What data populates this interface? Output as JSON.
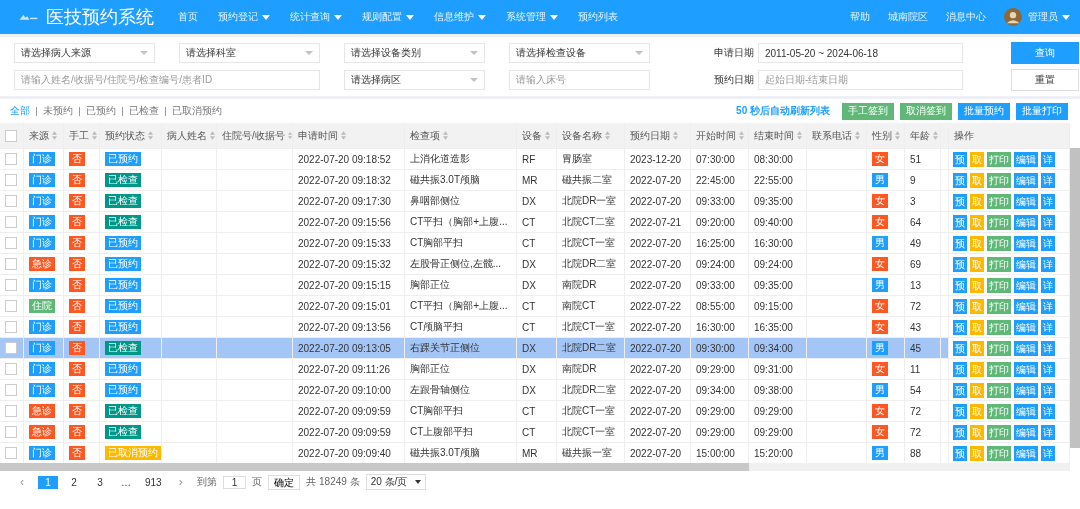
{
  "header": {
    "title": "医技预约系统",
    "nav": [
      {
        "label": "首页",
        "has_menu": false
      },
      {
        "label": "预约登记",
        "has_menu": true
      },
      {
        "label": "统计查询",
        "has_menu": true
      },
      {
        "label": "规则配置",
        "has_menu": true
      },
      {
        "label": "信息维护",
        "has_menu": true
      },
      {
        "label": "系统管理",
        "has_menu": true
      },
      {
        "label": "预约列表",
        "has_menu": false
      }
    ],
    "right_links": [
      "帮助",
      "城南院区",
      "消息中心"
    ],
    "user": "管理员"
  },
  "filters": {
    "row1": [
      {
        "kind": "select",
        "placeholder": "请选择病人来源"
      },
      {
        "kind": "select",
        "placeholder": "请选择科室"
      },
      {
        "kind": "select",
        "placeholder": "请选择设备类别"
      },
      {
        "kind": "select",
        "placeholder": "请选择检查设备"
      }
    ],
    "row2": [
      {
        "kind": "input",
        "placeholder": "请输入姓名/收据号/住院号/检查编号/患者ID"
      },
      {
        "kind": "select",
        "placeholder": "请选择病区"
      },
      {
        "kind": "input",
        "placeholder": "请输入床号"
      }
    ],
    "apply_date": {
      "label": "申请日期",
      "value": "2011-05-20 ~ 2024-06-18"
    },
    "book_date": {
      "label": "预约日期",
      "placeholder": "起始日期-结束日期"
    },
    "search_button": "查询",
    "reset_button": "重置"
  },
  "status_tabs": [
    {
      "label": "全部",
      "selected": true
    },
    {
      "label": "未预约",
      "selected": false
    },
    {
      "label": "已预约",
      "selected": false
    },
    {
      "label": "已检查",
      "selected": false
    },
    {
      "label": "已取消预约",
      "selected": false
    }
  ],
  "refresh_note": "50 秒后自动刷新列表",
  "toolbar_buttons": [
    {
      "label": "手工签到",
      "color": "#5fb878"
    },
    {
      "label": "取消签到",
      "color": "#5fb878"
    },
    {
      "label": "批量预约",
      "color": "#1e9fff"
    },
    {
      "label": "批量打印",
      "color": "#1e9fff"
    }
  ],
  "table": {
    "header_checkbox": {
      "checked": false
    },
    "columns": [
      {
        "label": "来源",
        "sortable": true
      },
      {
        "label": "手工",
        "sortable": true
      },
      {
        "label": "预约状态",
        "sortable": true
      },
      {
        "label": "病人姓名",
        "sortable": true
      },
      {
        "label": "住院号/收据号",
        "sortable": true
      },
      {
        "label": "申请时间",
        "sortable": true
      },
      {
        "label": "检查项",
        "sortable": true
      },
      {
        "label": "设备",
        "sortable": true
      },
      {
        "label": "设备名称",
        "sortable": true
      },
      {
        "label": "预约日期",
        "sortable": true
      },
      {
        "label": "开始时间",
        "sortable": true
      },
      {
        "label": "结束时间",
        "sortable": true
      },
      {
        "label": "联系电话",
        "sortable": true
      },
      {
        "label": "性别",
        "sortable": true
      },
      {
        "label": "年龄",
        "sortable": true
      },
      {
        "label": "操作",
        "sortable": false
      }
    ],
    "rows": [
      {
        "checked": false,
        "selected": false,
        "source": {
          "label": "门诊",
          "color": "#1e9fff"
        },
        "manual": {
          "label": "否",
          "color": "#ff5722"
        },
        "status": {
          "label": "已预约",
          "color": "#1e9fff"
        },
        "applied": "2022-07-20 09:18:52",
        "item": "上消化道造影",
        "device": "RF",
        "device_name": "胃肠室",
        "date": "2023-12-20",
        "start": "07:30:00",
        "end": "08:30:00",
        "gender": {
          "label": "女",
          "color": "#ff5722"
        },
        "age": "51",
        "actions": [
          {
            "label": "预",
            "color": "#1e9fff"
          },
          {
            "label": "取",
            "color": "#ffb800"
          },
          {
            "label": "打印",
            "color": "#5fb878"
          },
          {
            "label": "编辑",
            "color": "#1e9fff"
          },
          {
            "label": "详",
            "color": "#1e9fff"
          }
        ]
      },
      {
        "checked": false,
        "selected": false,
        "source": {
          "label": "门诊",
          "color": "#1e9fff"
        },
        "manual": {
          "label": "否",
          "color": "#ff5722"
        },
        "status": {
          "label": "已检查",
          "color": "#009688"
        },
        "applied": "2022-07-20 09:18:32",
        "item": "磁共振3.0T颅脑",
        "device": "MR",
        "device_name": "磁共振二室",
        "date": "2022-07-20",
        "start": "22:45:00",
        "end": "22:55:00",
        "gender": {
          "label": "男",
          "color": "#1e9fff"
        },
        "age": "9",
        "actions": [
          {
            "label": "预",
            "color": "#1e9fff"
          },
          {
            "label": "取",
            "color": "#ffb800"
          },
          {
            "label": "打印",
            "color": "#5fb878"
          },
          {
            "label": "编辑",
            "color": "#1e9fff"
          },
          {
            "label": "详",
            "color": "#1e9fff"
          }
        ]
      },
      {
        "checked": false,
        "selected": false,
        "source": {
          "label": "门诊",
          "color": "#1e9fff"
        },
        "manual": {
          "label": "否",
          "color": "#ff5722"
        },
        "status": {
          "label": "已检查",
          "color": "#009688"
        },
        "applied": "2022-07-20 09:17:30",
        "item": "鼻咽部侧位",
        "device": "DX",
        "device_name": "北院DR一室",
        "date": "2022-07-20",
        "start": "09:33:00",
        "end": "09:35:00",
        "gender": {
          "label": "女",
          "color": "#ff5722"
        },
        "age": "3",
        "actions": [
          {
            "label": "预",
            "color": "#1e9fff"
          },
          {
            "label": "取",
            "color": "#ffb800"
          },
          {
            "label": "打印",
            "color": "#5fb878"
          },
          {
            "label": "编辑",
            "color": "#1e9fff"
          },
          {
            "label": "详",
            "color": "#1e9fff"
          }
        ]
      },
      {
        "checked": false,
        "selected": false,
        "source": {
          "label": "门诊",
          "color": "#1e9fff"
        },
        "manual": {
          "label": "否",
          "color": "#ff5722"
        },
        "status": {
          "label": "已检查",
          "color": "#009688"
        },
        "applied": "2022-07-20 09:15:56",
        "item": "CT平扫（胸部+上腹...",
        "device": "CT",
        "device_name": "北院CT二室",
        "date": "2022-07-21",
        "start": "09:20:00",
        "end": "09:40:00",
        "gender": {
          "label": "女",
          "color": "#ff5722"
        },
        "age": "64",
        "actions": [
          {
            "label": "预",
            "color": "#1e9fff"
          },
          {
            "label": "取",
            "color": "#ffb800"
          },
          {
            "label": "打印",
            "color": "#5fb878"
          },
          {
            "label": "编辑",
            "color": "#1e9fff"
          },
          {
            "label": "详",
            "color": "#1e9fff"
          }
        ]
      },
      {
        "checked": false,
        "selected": false,
        "source": {
          "label": "门诊",
          "color": "#1e9fff"
        },
        "manual": {
          "label": "否",
          "color": "#ff5722"
        },
        "status": {
          "label": "已预约",
          "color": "#1e9fff"
        },
        "applied": "2022-07-20 09:15:33",
        "item": "CT胸部平扫",
        "device": "CT",
        "device_name": "北院CT一室",
        "date": "2022-07-20",
        "start": "16:25:00",
        "end": "16:30:00",
        "gender": {
          "label": "男",
          "color": "#1e9fff"
        },
        "age": "49",
        "actions": [
          {
            "label": "预",
            "color": "#1e9fff"
          },
          {
            "label": "取",
            "color": "#ffb800"
          },
          {
            "label": "打印",
            "color": "#5fb878"
          },
          {
            "label": "编辑",
            "color": "#1e9fff"
          },
          {
            "label": "详",
            "color": "#1e9fff"
          }
        ]
      },
      {
        "checked": false,
        "selected": false,
        "source": {
          "label": "急诊",
          "color": "#ff5722"
        },
        "manual": {
          "label": "否",
          "color": "#ff5722"
        },
        "status": {
          "label": "已预约",
          "color": "#1e9fff"
        },
        "applied": "2022-07-20 09:15:32",
        "item": "左股骨正侧位,左髋...",
        "device": "DX",
        "device_name": "北院DR二室",
        "date": "2022-07-20",
        "start": "09:24:00",
        "end": "09:24:00",
        "gender": {
          "label": "女",
          "color": "#ff5722"
        },
        "age": "69",
        "actions": [
          {
            "label": "预",
            "color": "#1e9fff"
          },
          {
            "label": "取",
            "color": "#ffb800"
          },
          {
            "label": "打印",
            "color": "#5fb878"
          },
          {
            "label": "编辑",
            "color": "#1e9fff"
          },
          {
            "label": "详",
            "color": "#1e9fff"
          }
        ]
      },
      {
        "checked": false,
        "selected": false,
        "source": {
          "label": "门诊",
          "color": "#1e9fff"
        },
        "manual": {
          "label": "否",
          "color": "#ff5722"
        },
        "status": {
          "label": "已预约",
          "color": "#1e9fff"
        },
        "applied": "2022-07-20 09:15:15",
        "item": "胸部正位",
        "device": "DX",
        "device_name": "南院DR",
        "date": "2022-07-20",
        "start": "09:33:00",
        "end": "09:35:00",
        "gender": {
          "label": "男",
          "color": "#1e9fff"
        },
        "age": "13",
        "actions": [
          {
            "label": "预",
            "color": "#1e9fff"
          },
          {
            "label": "取",
            "color": "#ffb800"
          },
          {
            "label": "打印",
            "color": "#5fb878"
          },
          {
            "label": "编辑",
            "color": "#1e9fff"
          },
          {
            "label": "详",
            "color": "#1e9fff"
          }
        ]
      },
      {
        "checked": false,
        "selected": false,
        "source": {
          "label": "住院",
          "color": "#5fb878"
        },
        "manual": {
          "label": "否",
          "color": "#ff5722"
        },
        "status": {
          "label": "已预约",
          "color": "#1e9fff"
        },
        "applied": "2022-07-20 09:15:01",
        "item": "CT平扫（胸部+上腹...",
        "device": "CT",
        "device_name": "南院CT",
        "date": "2022-07-22",
        "start": "08:55:00",
        "end": "09:15:00",
        "gender": {
          "label": "女",
          "color": "#ff5722"
        },
        "age": "72",
        "actions": [
          {
            "label": "预",
            "color": "#1e9fff"
          },
          {
            "label": "取",
            "color": "#ffb800"
          },
          {
            "label": "打印",
            "color": "#5fb878"
          },
          {
            "label": "编辑",
            "color": "#1e9fff"
          },
          {
            "label": "详",
            "color": "#1e9fff"
          }
        ]
      },
      {
        "checked": false,
        "selected": false,
        "source": {
          "label": "门诊",
          "color": "#1e9fff"
        },
        "manual": {
          "label": "否",
          "color": "#ff5722"
        },
        "status": {
          "label": "已预约",
          "color": "#1e9fff"
        },
        "applied": "2022-07-20 09:13:56",
        "item": "CT颅脑平扫",
        "device": "CT",
        "device_name": "北院CT一室",
        "date": "2022-07-20",
        "start": "16:30:00",
        "end": "16:35:00",
        "gender": {
          "label": "女",
          "color": "#ff5722"
        },
        "age": "43",
        "actions": [
          {
            "label": "预",
            "color": "#1e9fff"
          },
          {
            "label": "取",
            "color": "#ffb800"
          },
          {
            "label": "打印",
            "color": "#5fb878"
          },
          {
            "label": "编辑",
            "color": "#1e9fff"
          },
          {
            "label": "详",
            "color": "#1e9fff"
          }
        ]
      },
      {
        "checked": false,
        "selected": true,
        "source": {
          "label": "门诊",
          "color": "#1e9fff"
        },
        "manual": {
          "label": "否",
          "color": "#ff5722"
        },
        "status": {
          "label": "已检查",
          "color": "#009688"
        },
        "applied": "2022-07-20 09:13:05",
        "item": "右踝关节正侧位",
        "device": "DX",
        "device_name": "北院DR二室",
        "date": "2022-07-20",
        "start": "09:30:00",
        "end": "09:34:00",
        "gender": {
          "label": "男",
          "color": "#1e9fff"
        },
        "age": "45",
        "actions": [
          {
            "label": "预",
            "color": "#1e9fff"
          },
          {
            "label": "取",
            "color": "#ffb800"
          },
          {
            "label": "打印",
            "color": "#5fb878"
          },
          {
            "label": "编辑",
            "color": "#1e9fff"
          },
          {
            "label": "详",
            "color": "#1e9fff"
          }
        ]
      },
      {
        "checked": false,
        "selected": false,
        "source": {
          "label": "门诊",
          "color": "#1e9fff"
        },
        "manual": {
          "label": "否",
          "color": "#ff5722"
        },
        "status": {
          "label": "已预约",
          "color": "#1e9fff"
        },
        "applied": "2022-07-20 09:11:26",
        "item": "胸部正位",
        "device": "DX",
        "device_name": "南院DR",
        "date": "2022-07-20",
        "start": "09:29:00",
        "end": "09:31:00",
        "gender": {
          "label": "女",
          "color": "#ff5722"
        },
        "age": "11",
        "actions": [
          {
            "label": "预",
            "color": "#1e9fff"
          },
          {
            "label": "取",
            "color": "#ffb800"
          },
          {
            "label": "打印",
            "color": "#5fb878"
          },
          {
            "label": "编辑",
            "color": "#1e9fff"
          },
          {
            "label": "详",
            "color": "#1e9fff"
          }
        ]
      },
      {
        "checked": false,
        "selected": false,
        "source": {
          "label": "门诊",
          "color": "#1e9fff"
        },
        "manual": {
          "label": "否",
          "color": "#ff5722"
        },
        "status": {
          "label": "已预约",
          "color": "#1e9fff"
        },
        "applied": "2022-07-20 09:10:00",
        "item": "左跟骨轴侧位",
        "device": "DX",
        "device_name": "北院DR二室",
        "date": "2022-07-20",
        "start": "09:34:00",
        "end": "09:38:00",
        "gender": {
          "label": "男",
          "color": "#1e9fff"
        },
        "age": "54",
        "actions": [
          {
            "label": "预",
            "color": "#1e9fff"
          },
          {
            "label": "取",
            "color": "#ffb800"
          },
          {
            "label": "打印",
            "color": "#5fb878"
          },
          {
            "label": "编辑",
            "color": "#1e9fff"
          },
          {
            "label": "详",
            "color": "#1e9fff"
          }
        ]
      },
      {
        "checked": false,
        "selected": false,
        "source": {
          "label": "急诊",
          "color": "#ff5722"
        },
        "manual": {
          "label": "否",
          "color": "#ff5722"
        },
        "status": {
          "label": "已检查",
          "color": "#009688"
        },
        "applied": "2022-07-20 09:09:59",
        "item": "CT胸部平扫",
        "device": "CT",
        "device_name": "北院CT一室",
        "date": "2022-07-20",
        "start": "09:29:00",
        "end": "09:29:00",
        "gender": {
          "label": "女",
          "color": "#ff5722"
        },
        "age": "72",
        "actions": [
          {
            "label": "预",
            "color": "#1e9fff"
          },
          {
            "label": "取",
            "color": "#ffb800"
          },
          {
            "label": "打印",
            "color": "#5fb878"
          },
          {
            "label": "编辑",
            "color": "#1e9fff"
          },
          {
            "label": "详",
            "color": "#1e9fff"
          }
        ]
      },
      {
        "checked": false,
        "selected": false,
        "source": {
          "label": "急诊",
          "color": "#ff5722"
        },
        "manual": {
          "label": "否",
          "color": "#ff5722"
        },
        "status": {
          "label": "已检查",
          "color": "#009688"
        },
        "applied": "2022-07-20 09:09:59",
        "item": "CT上腹部平扫",
        "device": "CT",
        "device_name": "北院CT一室",
        "date": "2022-07-20",
        "start": "09:29:00",
        "end": "09:29:00",
        "gender": {
          "label": "女",
          "color": "#ff5722"
        },
        "age": "72",
        "actions": [
          {
            "label": "预",
            "color": "#1e9fff"
          },
          {
            "label": "取",
            "color": "#ffb800"
          },
          {
            "label": "打印",
            "color": "#5fb878"
          },
          {
            "label": "编辑",
            "color": "#1e9fff"
          },
          {
            "label": "详",
            "color": "#1e9fff"
          }
        ]
      },
      {
        "checked": false,
        "selected": false,
        "source": {
          "label": "门诊",
          "color": "#1e9fff"
        },
        "manual": {
          "label": "否",
          "color": "#ff5722"
        },
        "status": {
          "label": "已取消预约",
          "color": "#ffb800"
        },
        "applied": "2022-07-20 09:09:40",
        "item": "磁共振3.0T颅脑",
        "device": "MR",
        "device_name": "磁共振一室",
        "date": "2022-07-20",
        "start": "15:00:00",
        "end": "15:20:00",
        "gender": {
          "label": "男",
          "color": "#1e9fff"
        },
        "age": "88",
        "actions": [
          {
            "label": "预",
            "color": "#1e9fff"
          },
          {
            "label": "取",
            "color": "#ffb800"
          },
          {
            "label": "打印",
            "color": "#5fb878"
          },
          {
            "label": "编辑",
            "color": "#1e9fff"
          },
          {
            "label": "详",
            "color": "#1e9fff"
          }
        ]
      }
    ]
  },
  "pagination": {
    "prev": "‹",
    "pages": [
      {
        "label": "1",
        "selected": true
      },
      {
        "label": "2",
        "selected": false
      },
      {
        "label": "3",
        "selected": false
      },
      {
        "label": "…",
        "selected": false
      },
      {
        "label": "913",
        "selected": false
      }
    ],
    "next": "›",
    "goto_label": "到第",
    "goto_value": "1",
    "page_unit": "页",
    "confirm": "确定",
    "total": "共 18249 条",
    "page_size": "20 条/页"
  }
}
